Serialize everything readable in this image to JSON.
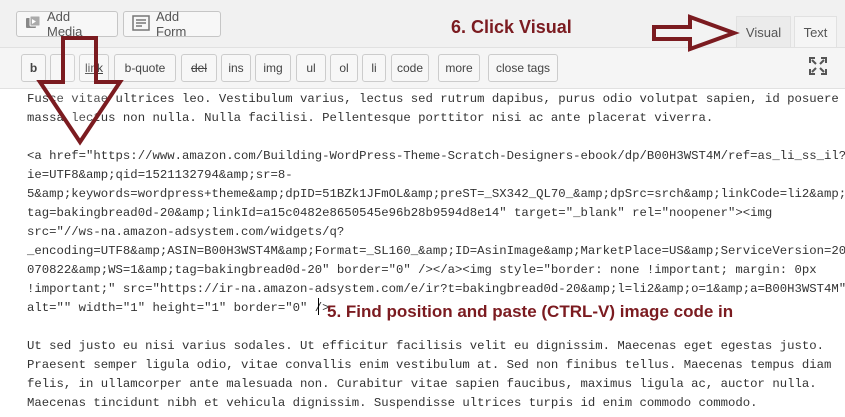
{
  "media": {
    "add_media": "Add Media",
    "add_form": "Add Form"
  },
  "tabs": {
    "visual": "Visual",
    "text": "Text"
  },
  "toolbar": {
    "buttons": [
      "b",
      "i",
      "link",
      "b-quote",
      "del",
      "ins",
      "img",
      "ul",
      "ol",
      "li",
      "code",
      "more",
      "close tags"
    ]
  },
  "editor": {
    "lines": [
      "Fusce vitae ultrices leo. Vestibulum varius, lectus sed rutrum dapibus, purus odio volutpat sapien, id posuere",
      "massa lectus non nulla. Nulla facilisi. Pellentesque porttitor nisi ac ante placerat viverra.",
      "",
      "<a href=\"https://www.amazon.com/Building-WordPress-Theme-Scratch-Designers-ebook/dp/B00H3WST4M/ref=as_li_ss_il?",
      "ie=UTF8&amp;qid=1521132794&amp;sr=8-",
      "5&amp;keywords=wordpress+theme&amp;dpID=51BZk1JFmOL&amp;preST=_SX342_QL70_&amp;dpSrc=srch&amp;linkCode=li2&amp;",
      "tag=bakingbread0d-20&amp;linkId=a15c0482e8650545e96b28b9594d8e14\" target=\"_blank\" rel=\"noopener\"><img",
      "src=\"//ws-na.amazon-adsystem.com/widgets/q?",
      "_encoding=UTF8&amp;ASIN=B00H3WST4M&amp;Format=_SL160_&amp;ID=AsinImage&amp;MarketPlace=US&amp;ServiceVersion=20",
      "070822&amp;WS=1&amp;tag=bakingbread0d-20\" border=\"0\" /></a><img style=\"border: none !important; margin: 0px",
      "!important;\" src=\"https://ir-na.amazon-adsystem.com/e/ir?t=bakingbread0d-20&amp;l=li2&amp;o=1&amp;a=B00H3WST4M\"",
      "alt=\"\" width=\"1\" height=\"1\" border=\"0\" />",
      "",
      "Ut sed justo eu nisi varius sodales. Ut efficitur facilisis velit eu dignissim. Maecenas eget egestas justo.",
      "Praesent semper ligula odio, vitae convallis enim vestibulum at. Sed non finibus tellus. Maecenas tempus diam",
      "felis, in ullamcorper ante malesuada non. Curabitur vitae sapien faucibus, maximus ligula ac, auctor nulla.",
      "Maecenas tincidunt nibh et vehicula dignissim. Suspendisse ultrices turpis id enim commodo commodo."
    ]
  },
  "annotations": {
    "click_visual": "6. Click Visual",
    "paste_instruction": "5. Find position and paste (CTRL-V) image code in"
  },
  "colors": {
    "annotation": "#7b1b20",
    "arrow_fill": "#ffffff",
    "arrow_stroke": "#7b1b20"
  },
  "icons": {
    "add_media": "media-icon",
    "add_form": "form-icon",
    "fullscreen": "fullscreen-icon"
  }
}
